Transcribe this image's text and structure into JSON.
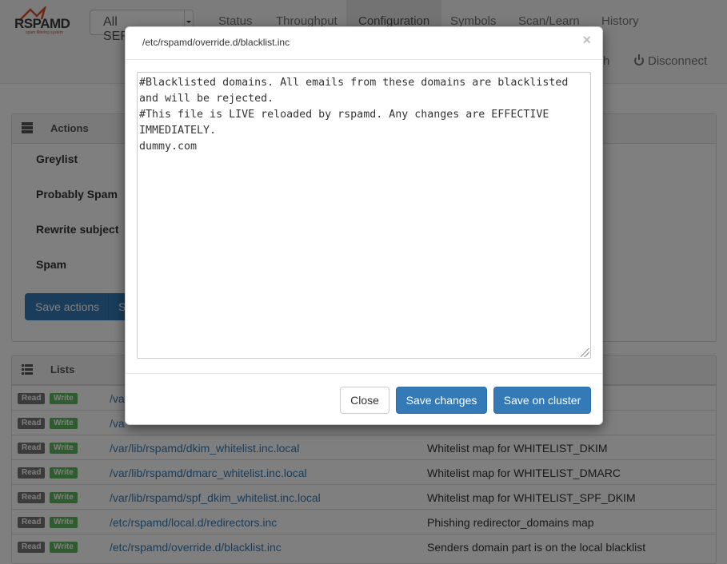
{
  "app": {
    "logo_text": "RSPAMD",
    "logo_sub": "spam filtering system"
  },
  "navbar": {
    "server_select": "All SERVERS",
    "tabs": [
      "Status",
      "Throughput",
      "Configuration",
      "Symbols",
      "Scan/Learn",
      "History"
    ],
    "active_tab": "Configuration",
    "right_partial": "h",
    "disconnect": "Disconnect"
  },
  "actions_panel": {
    "title": "Actions",
    "items": [
      "Greylist",
      "Probably Spam",
      "Rewrite subject",
      "Spam"
    ],
    "save_button": "Save actions",
    "save_cluster_partial": "S"
  },
  "lists_panel": {
    "title": "Lists",
    "read_label": "Read",
    "write_label": "Write",
    "rows": [
      {
        "path": "/va",
        "desc": ""
      },
      {
        "path": "/va",
        "desc": ""
      },
      {
        "path": "/var/lib/rspamd/dkim_whitelist.inc.local",
        "desc": "Whitelist map for WHITELIST_DKIM"
      },
      {
        "path": "/var/lib/rspamd/dmarc_whitelist.inc.local",
        "desc": "Whitelist map for WHITELIST_DMARC"
      },
      {
        "path": "/var/lib/rspamd/spf_dkim_whitelist.inc.local",
        "desc": "Whitelist map for WHITELIST_SPF_DKIM"
      },
      {
        "path": "/etc/rspamd/local.d/redirectors.inc",
        "desc": "Phishing redirector_domains map"
      },
      {
        "path": "/etc/rspamd/override.d/blacklist.inc",
        "desc": "Senders domain part is on the local blacklist"
      }
    ]
  },
  "modal": {
    "title": "/etc/rspamd/override.d/blacklist.inc",
    "close_symbol": "×",
    "content_lines": [
      "#Blacklisted domains. All emails from these domains are blacklisted",
      "and will be rejected.",
      "#This file is LIVE reloaded by rspamd. Any changes are EFFECTIVE",
      "IMMEDIATELY.",
      "dummy.com"
    ],
    "buttons": {
      "close": "Close",
      "save": "Save changes",
      "save_cluster": "Save on cluster"
    }
  }
}
